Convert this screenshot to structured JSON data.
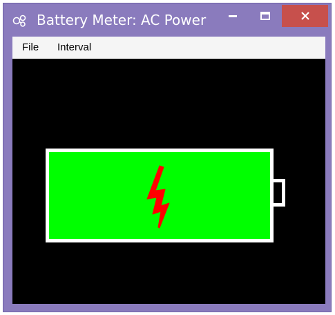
{
  "window": {
    "title": "Battery Meter: AC Power",
    "app_icon": "battery-meter-app-icon",
    "controls": {
      "minimize_icon": "minimize-icon",
      "maximize_icon": "maximize-icon",
      "close_icon": "close-icon"
    }
  },
  "menubar": {
    "items": [
      "File",
      "Interval"
    ]
  },
  "battery": {
    "charge_level": 1.0,
    "charging_icon": "lightning-bolt-icon",
    "colors": {
      "fill": "#00ff00",
      "outline": "#ffffff",
      "bolt": "#ff0000",
      "background": "#000000"
    }
  }
}
